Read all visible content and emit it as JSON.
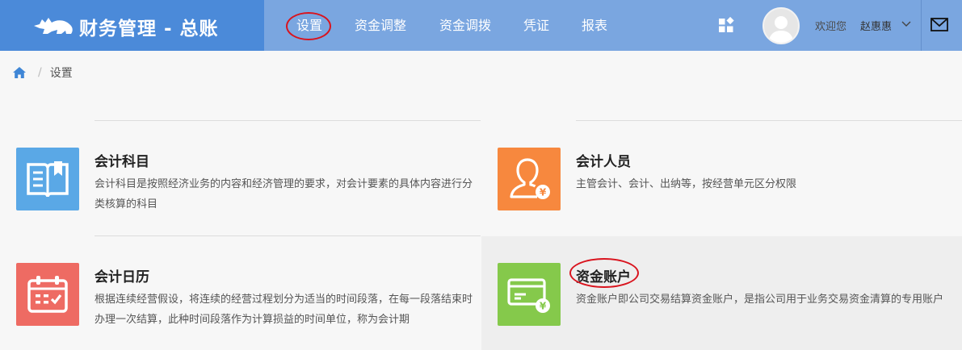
{
  "app": {
    "title": "财务管理 - 总账",
    "logo_icon": "rhino-logo-icon"
  },
  "nav": {
    "items": [
      {
        "label": "设置",
        "active": true
      },
      {
        "label": "资金调整",
        "active": false
      },
      {
        "label": "资金调拨",
        "active": false
      },
      {
        "label": "凭证",
        "active": false
      },
      {
        "label": "报表",
        "active": false
      }
    ]
  },
  "user": {
    "welcome": "欢迎您",
    "name": "赵惠惠"
  },
  "breadcrumb": {
    "current": "设置"
  },
  "cards": [
    {
      "title": "会计科目",
      "desc": "会计科目是按照经济业务的内容和经济管理的要求，对会计要素的具体内容进行分类核算的科目",
      "icon": "book-icon",
      "color": "#5aa8e6"
    },
    {
      "title": "会计人员",
      "desc": "主管会计、会计、出纳等，按经营单元区分权限",
      "icon": "accountant-person-icon",
      "color": "#f7883e"
    },
    {
      "title": "会计日历",
      "desc": "根据连续经营假设，将连续的经营过程划分为适当的时间段落，在每一段落结束时办理一次结算，此种时间段落作为计算损益的时间单位，称为会计期",
      "icon": "calendar-icon",
      "color": "#ee6b63"
    },
    {
      "title": "资金账户",
      "desc": "资金账户即公司交易结算资金账户，是指公司用于业务交易资金清算的专用账户",
      "icon": "fund-account-card-icon",
      "color": "#85c94b"
    }
  ],
  "colors": {
    "header": "#7aa6e0",
    "brand": "#4b8ad9",
    "annotation": "#d9141e"
  }
}
